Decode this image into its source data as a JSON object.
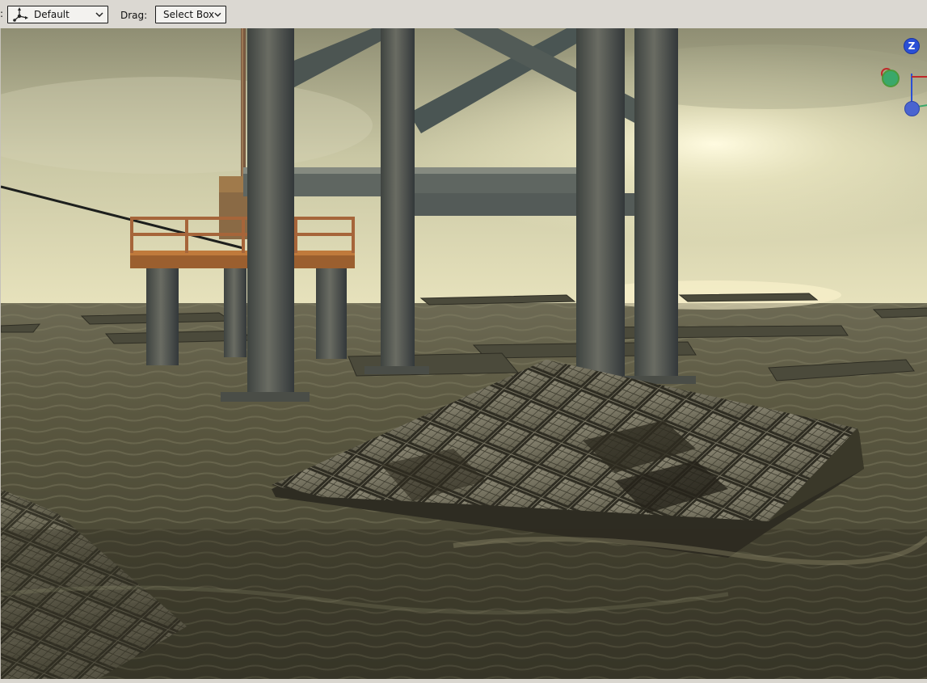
{
  "toolbar": {
    "prefix_text": ":",
    "orientation_value": "Default",
    "drag_label": "Drag:",
    "drag_value": "Select Box",
    "orientation_icon": "transform-orientation-icon",
    "dropdown_icon": "chevron-down-icon"
  },
  "viewport": {
    "scene": "offshore oil rig legs standing in murky water with a floating tiled platform",
    "gizmo": {
      "z_label": "Z",
      "colors": {
        "x": "#c0282a",
        "y": "#3aa86a",
        "z": "#2a4fd6"
      }
    }
  }
}
